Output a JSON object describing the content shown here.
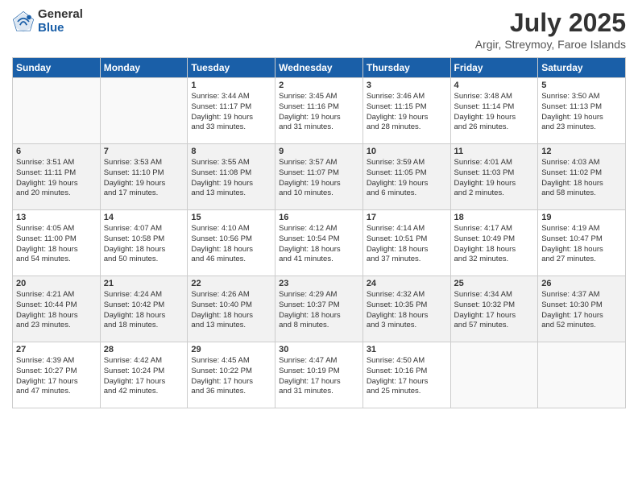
{
  "header": {
    "logo_general": "General",
    "logo_blue": "Blue",
    "title": "July 2025",
    "subtitle": "Argir, Streymoy, Faroe Islands"
  },
  "days_of_week": [
    "Sunday",
    "Monday",
    "Tuesday",
    "Wednesday",
    "Thursday",
    "Friday",
    "Saturday"
  ],
  "weeks": [
    [
      {
        "day": "",
        "info": ""
      },
      {
        "day": "",
        "info": ""
      },
      {
        "day": "1",
        "info": "Sunrise: 3:44 AM\nSunset: 11:17 PM\nDaylight: 19 hours\nand 33 minutes."
      },
      {
        "day": "2",
        "info": "Sunrise: 3:45 AM\nSunset: 11:16 PM\nDaylight: 19 hours\nand 31 minutes."
      },
      {
        "day": "3",
        "info": "Sunrise: 3:46 AM\nSunset: 11:15 PM\nDaylight: 19 hours\nand 28 minutes."
      },
      {
        "day": "4",
        "info": "Sunrise: 3:48 AM\nSunset: 11:14 PM\nDaylight: 19 hours\nand 26 minutes."
      },
      {
        "day": "5",
        "info": "Sunrise: 3:50 AM\nSunset: 11:13 PM\nDaylight: 19 hours\nand 23 minutes."
      }
    ],
    [
      {
        "day": "6",
        "info": "Sunrise: 3:51 AM\nSunset: 11:11 PM\nDaylight: 19 hours\nand 20 minutes."
      },
      {
        "day": "7",
        "info": "Sunrise: 3:53 AM\nSunset: 11:10 PM\nDaylight: 19 hours\nand 17 minutes."
      },
      {
        "day": "8",
        "info": "Sunrise: 3:55 AM\nSunset: 11:08 PM\nDaylight: 19 hours\nand 13 minutes."
      },
      {
        "day": "9",
        "info": "Sunrise: 3:57 AM\nSunset: 11:07 PM\nDaylight: 19 hours\nand 10 minutes."
      },
      {
        "day": "10",
        "info": "Sunrise: 3:59 AM\nSunset: 11:05 PM\nDaylight: 19 hours\nand 6 minutes."
      },
      {
        "day": "11",
        "info": "Sunrise: 4:01 AM\nSunset: 11:03 PM\nDaylight: 19 hours\nand 2 minutes."
      },
      {
        "day": "12",
        "info": "Sunrise: 4:03 AM\nSunset: 11:02 PM\nDaylight: 18 hours\nand 58 minutes."
      }
    ],
    [
      {
        "day": "13",
        "info": "Sunrise: 4:05 AM\nSunset: 11:00 PM\nDaylight: 18 hours\nand 54 minutes."
      },
      {
        "day": "14",
        "info": "Sunrise: 4:07 AM\nSunset: 10:58 PM\nDaylight: 18 hours\nand 50 minutes."
      },
      {
        "day": "15",
        "info": "Sunrise: 4:10 AM\nSunset: 10:56 PM\nDaylight: 18 hours\nand 46 minutes."
      },
      {
        "day": "16",
        "info": "Sunrise: 4:12 AM\nSunset: 10:54 PM\nDaylight: 18 hours\nand 41 minutes."
      },
      {
        "day": "17",
        "info": "Sunrise: 4:14 AM\nSunset: 10:51 PM\nDaylight: 18 hours\nand 37 minutes."
      },
      {
        "day": "18",
        "info": "Sunrise: 4:17 AM\nSunset: 10:49 PM\nDaylight: 18 hours\nand 32 minutes."
      },
      {
        "day": "19",
        "info": "Sunrise: 4:19 AM\nSunset: 10:47 PM\nDaylight: 18 hours\nand 27 minutes."
      }
    ],
    [
      {
        "day": "20",
        "info": "Sunrise: 4:21 AM\nSunset: 10:44 PM\nDaylight: 18 hours\nand 23 minutes."
      },
      {
        "day": "21",
        "info": "Sunrise: 4:24 AM\nSunset: 10:42 PM\nDaylight: 18 hours\nand 18 minutes."
      },
      {
        "day": "22",
        "info": "Sunrise: 4:26 AM\nSunset: 10:40 PM\nDaylight: 18 hours\nand 13 minutes."
      },
      {
        "day": "23",
        "info": "Sunrise: 4:29 AM\nSunset: 10:37 PM\nDaylight: 18 hours\nand 8 minutes."
      },
      {
        "day": "24",
        "info": "Sunrise: 4:32 AM\nSunset: 10:35 PM\nDaylight: 18 hours\nand 3 minutes."
      },
      {
        "day": "25",
        "info": "Sunrise: 4:34 AM\nSunset: 10:32 PM\nDaylight: 17 hours\nand 57 minutes."
      },
      {
        "day": "26",
        "info": "Sunrise: 4:37 AM\nSunset: 10:30 PM\nDaylight: 17 hours\nand 52 minutes."
      }
    ],
    [
      {
        "day": "27",
        "info": "Sunrise: 4:39 AM\nSunset: 10:27 PM\nDaylight: 17 hours\nand 47 minutes."
      },
      {
        "day": "28",
        "info": "Sunrise: 4:42 AM\nSunset: 10:24 PM\nDaylight: 17 hours\nand 42 minutes."
      },
      {
        "day": "29",
        "info": "Sunrise: 4:45 AM\nSunset: 10:22 PM\nDaylight: 17 hours\nand 36 minutes."
      },
      {
        "day": "30",
        "info": "Sunrise: 4:47 AM\nSunset: 10:19 PM\nDaylight: 17 hours\nand 31 minutes."
      },
      {
        "day": "31",
        "info": "Sunrise: 4:50 AM\nSunset: 10:16 PM\nDaylight: 17 hours\nand 25 minutes."
      },
      {
        "day": "",
        "info": ""
      },
      {
        "day": "",
        "info": ""
      }
    ]
  ]
}
